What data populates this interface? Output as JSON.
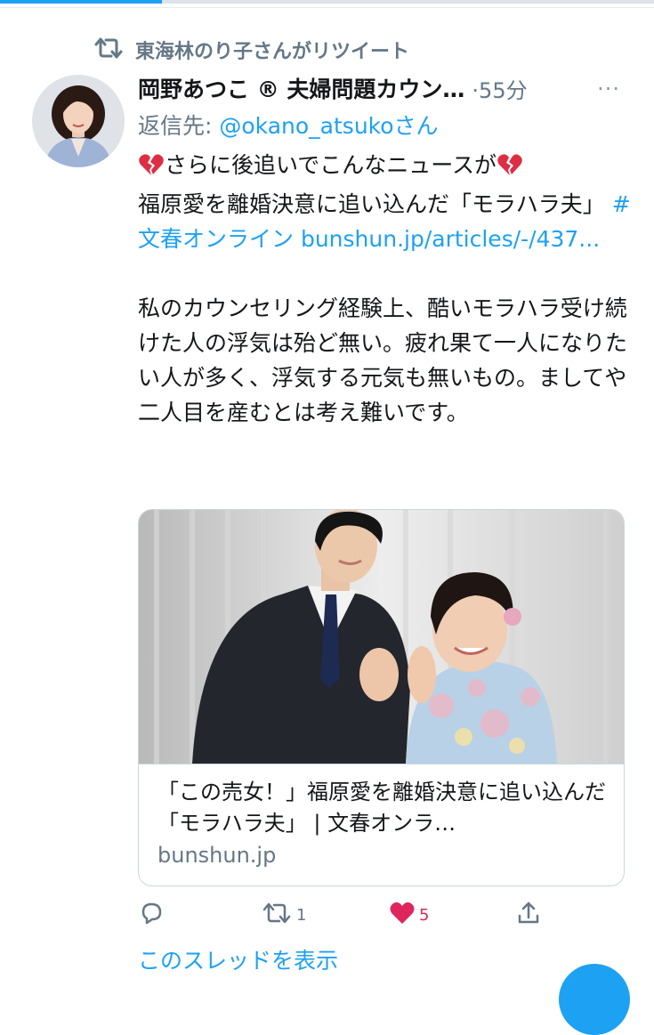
{
  "retweet": {
    "label": "東海林のり子さんがリツイート"
  },
  "author": {
    "display_name": "岡野あつこ ® 夫婦問題カウン…",
    "time": "·55分"
  },
  "reply": {
    "prefix": "返信先: ",
    "handle": "@okano_atsuko",
    "suffix": "さん"
  },
  "tweet": {
    "line1": "さらに後追いでこんなニュースが",
    "line2_prefix": "福原愛を離婚決意に追い込んだ「モラハラ夫」",
    "hashtag": "#文春オンライン",
    "url": "bunshun.jp/articles/-/437...",
    "paragraph2": "私のカウンセリング経験上、酷いモラハラ受け続けた人の浮気は殆ど無い。疲れ果て一人になりたい人が多く、浮気する元気も無いもの。ましてや二人目を産むとは考え難いです。"
  },
  "card": {
    "title": "「この売女！」福原愛を離婚決意に追い込んだ「モラハラ夫」 | 文春オンラ…",
    "domain": "bunshun.jp"
  },
  "actions": {
    "retweet_count": "1",
    "like_count": "5"
  },
  "thread_link": "このスレッドを表示",
  "colors": {
    "accent": "#1da1f2",
    "like": "#e0245e",
    "muted": "#657786",
    "broken_heart": "#dd2e44"
  },
  "icons": [
    "retweet-icon",
    "more-icon",
    "broken-heart-icon",
    "reply-icon",
    "like-icon",
    "share-icon"
  ]
}
